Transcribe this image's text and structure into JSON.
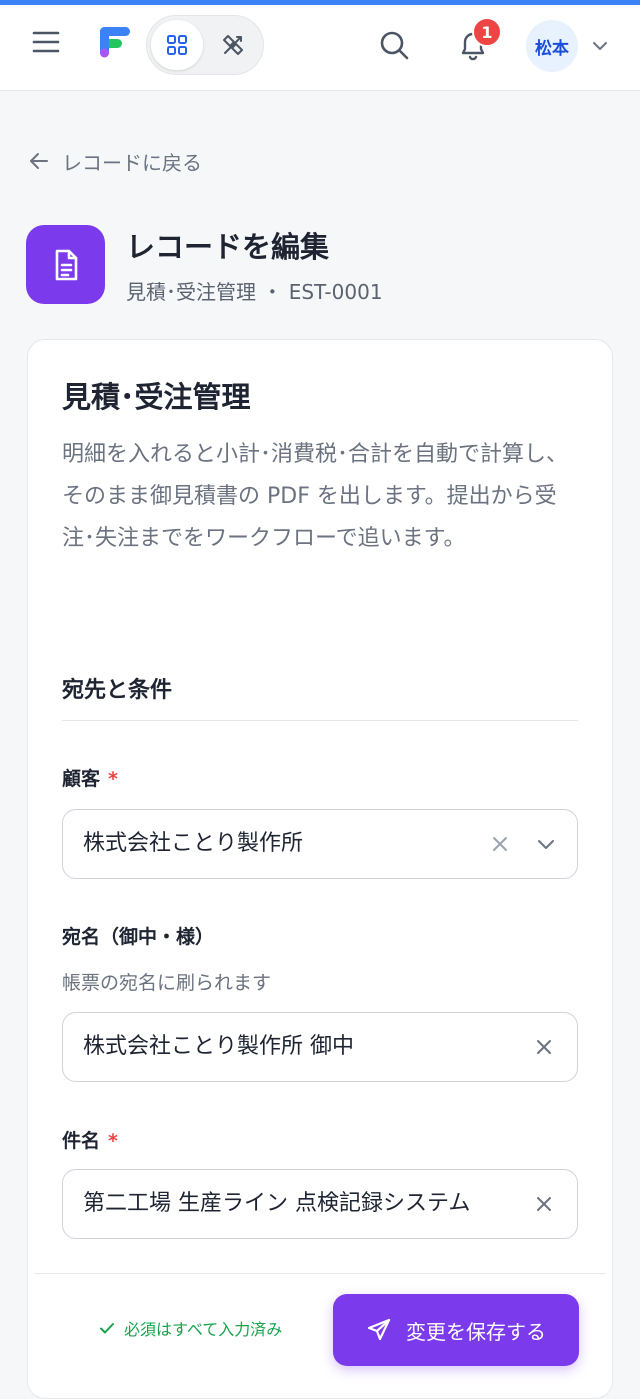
{
  "header": {
    "notification_count": "1",
    "user_initial": "松本",
    "active_mode": "grid"
  },
  "nav": {
    "back_label": "レコードに戻る"
  },
  "page": {
    "title": "レコードを編集",
    "subtitle": "見積･受注管理 ・ EST-0001"
  },
  "form": {
    "title": "見積･受注管理",
    "description": "明細を入れると小計･消費税･合計を自動で計算し、そのまま御見積書の PDF を出します。提出から受注･失注までをワークフローで追います。",
    "section_title": "宛先と条件",
    "fields": [
      {
        "label": "顧客",
        "required": true,
        "value": "株式会社ことり製作所",
        "type": "select"
      },
      {
        "label": "宛名（御中・様）",
        "required": false,
        "hint": "帳票の宛名に刷られます",
        "value": "株式会社ことり製作所 御中",
        "type": "text"
      },
      {
        "label": "件名",
        "required": true,
        "value": "第二工場 生産ライン 点検記録システム",
        "type": "text"
      }
    ],
    "required_mark": "*"
  },
  "footer": {
    "status": "必須はすべて入力済み",
    "save_label": "変更を保存する"
  },
  "colors": {
    "accent": "#7c3aed",
    "primary_blue": "#3b82f6",
    "success": "#16a34a",
    "danger": "#ef4444"
  }
}
